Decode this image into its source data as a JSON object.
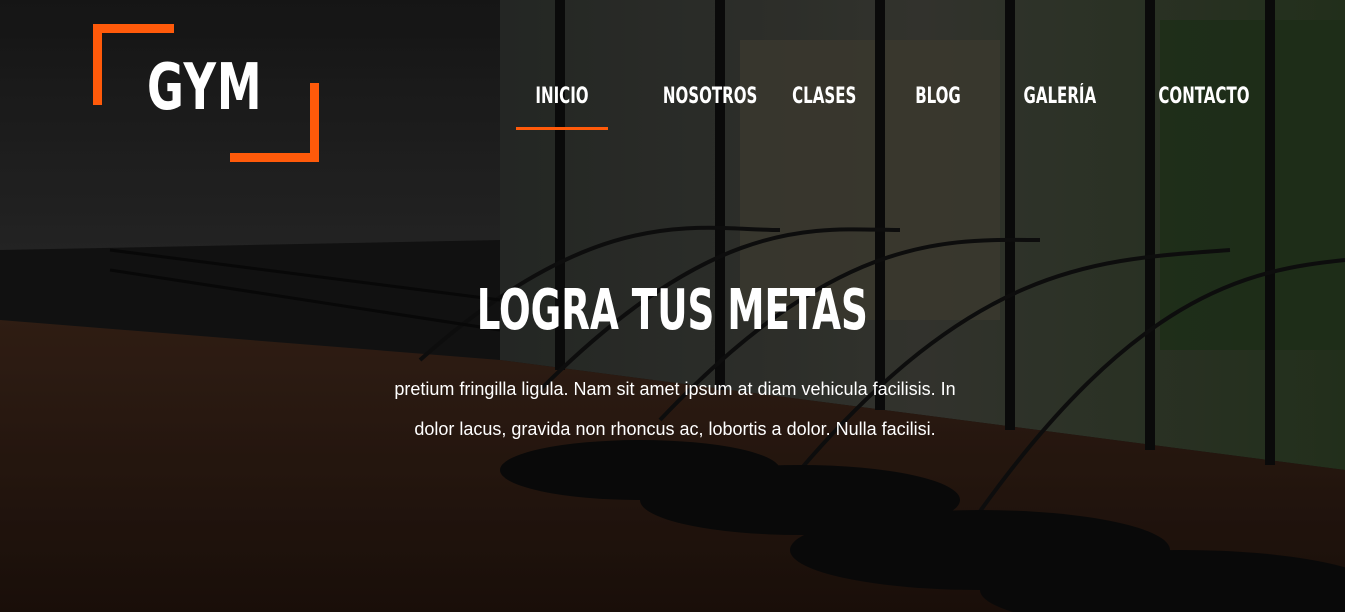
{
  "brand": {
    "logo_text": "GYM",
    "accent_color": "#ff5a0a"
  },
  "nav": {
    "items": [
      {
        "label": "INICIO",
        "active": true
      },
      {
        "label": "NOSOTROS",
        "active": false
      },
      {
        "label": "CLASES",
        "active": false
      },
      {
        "label": "BLOG",
        "active": false
      },
      {
        "label": "GALERÍA",
        "active": false
      },
      {
        "label": "CONTACTO",
        "active": false
      }
    ]
  },
  "hero": {
    "title": "LOGRA TUS METAS",
    "body": "pretium fringilla ligula. Nam sit amet ipsum at diam vehicula facilisis. In dolor lacus, gravida non rhoncus ac, lobortis a dolor. Nulla facilisi."
  }
}
